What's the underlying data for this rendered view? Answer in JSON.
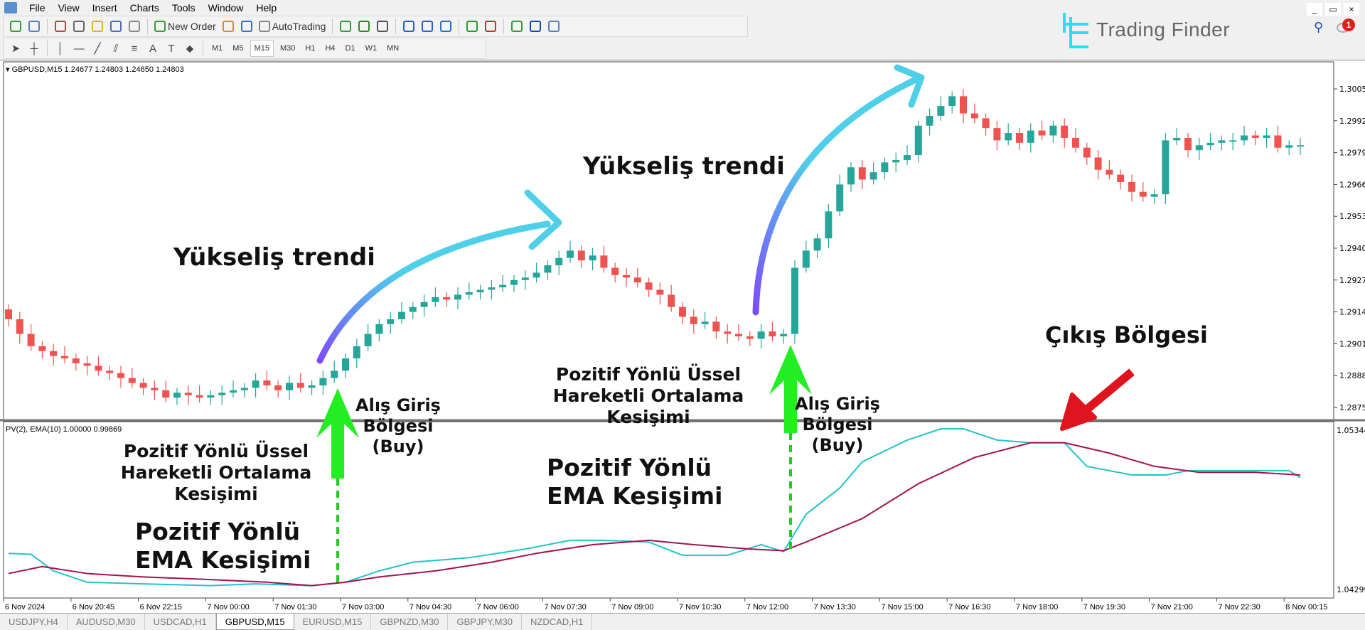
{
  "menu": [
    "File",
    "View",
    "Insert",
    "Charts",
    "Tools",
    "Window",
    "Help"
  ],
  "toolbar": {
    "new_order": "New Order",
    "autotrading": "AutoTrading",
    "icons": [
      "new-chart-icon",
      "profiles-icon",
      "market-watch-icon",
      "navigator-icon",
      "favorites-icon",
      "terminal-icon",
      "strategy-tester-icon",
      "new-order-icon",
      "metaeditor-icon",
      "signals-icon",
      "autotrading-icon",
      "bar-chart-icon",
      "candlestick-icon",
      "line-chart-icon",
      "zoom-in-icon",
      "zoom-out-icon",
      "tile-windows-icon",
      "autoscroll-icon",
      "chart-shift-icon",
      "indicators-icon",
      "periods-icon",
      "templates-icon"
    ]
  },
  "drawing_tools": [
    "cursor-icon",
    "crosshair-icon",
    "vertical-line-icon",
    "horizontal-line-icon",
    "trendline-icon",
    "channel-icon",
    "fibonacci-icon",
    "text-icon",
    "text-label-icon",
    "arrows-icon"
  ],
  "timeframes": [
    "M1",
    "M5",
    "M15",
    "M30",
    "H1",
    "H4",
    "D1",
    "W1",
    "MN"
  ],
  "active_timeframe": "M15",
  "logo": {
    "text": "Trading Finder",
    "color": "#1ee3f0"
  },
  "notifications": {
    "count": "1"
  },
  "window_controls": [
    "_",
    "▭",
    "×"
  ],
  "chart": {
    "header": "GBPUSD,M15  1.24677 1.24803 1.24650 1.24803",
    "indicator_header": "PV(2), EMA(10) 1.00000 0.99869",
    "price_ticks": [
      "1.30050",
      "1.29920",
      "1.29790",
      "1.29660",
      "1.29530",
      "1.29400",
      "1.29270",
      "1.29140",
      "1.29010",
      "1.28880",
      "1.28750"
    ],
    "indicator_ticks": [
      "1.05344",
      "1.04299"
    ],
    "time_labels": [
      "6 Nov 2024",
      "6 Nov 20:45",
      "6 Nov 22:15",
      "7 Nov 00:00",
      "7 Nov 01:30",
      "7 Nov 03:00",
      "7 Nov 04:30",
      "7 Nov 06:00",
      "7 Nov 07:30",
      "7 Nov 09:00",
      "7 Nov 10:30",
      "7 Nov 12:00",
      "7 Nov 13:30",
      "7 Nov 15:00",
      "7 Nov 16:30",
      "7 Nov 18:00",
      "7 Nov 19:30",
      "7 Nov 21:00",
      "7 Nov 22:30",
      "8 Nov 00:15"
    ]
  },
  "chart_data": {
    "type": "candlestick",
    "symbol": "GBPUSD",
    "timeframe": "M15",
    "ylim": [
      1.287,
      1.301
    ],
    "indicator_ylim": [
      1.04299,
      1.05344
    ],
    "colors": {
      "bull": "#26a69a",
      "bear": "#ef5350",
      "pv": "#22c4c8",
      "ema": "#a3124f"
    },
    "close": [
      1.2911,
      1.2905,
      1.29,
      1.2898,
      1.2896,
      1.2895,
      1.2893,
      1.2892,
      1.289,
      1.2889,
      1.2887,
      1.2885,
      1.2883,
      1.2882,
      1.2879,
      1.2881,
      1.288,
      1.2879,
      1.288,
      1.2881,
      1.2882,
      1.2883,
      1.2886,
      1.2884,
      1.2882,
      1.2885,
      1.2883,
      1.2884,
      1.2887,
      1.289,
      1.2895,
      1.29,
      1.2905,
      1.2909,
      1.2911,
      1.2914,
      1.2916,
      1.2918,
      1.292,
      1.2919,
      1.2921,
      1.2922,
      1.2923,
      1.2924,
      1.2925,
      1.2927,
      1.2928,
      1.293,
      1.2933,
      1.2936,
      1.2939,
      1.2935,
      1.2937,
      1.2932,
      1.2929,
      1.2928,
      1.2926,
      1.2923,
      1.2921,
      1.2916,
      1.2912,
      1.2909,
      1.291,
      1.2906,
      1.2905,
      1.2904,
      1.2903,
      1.2906,
      1.2904,
      1.2905,
      1.2932,
      1.2939,
      1.2944,
      1.2955,
      1.2966,
      1.2973,
      1.2968,
      1.2971,
      1.2975,
      1.2976,
      1.2978,
      1.299,
      1.2994,
      1.2998,
      1.3002,
      1.2995,
      1.2993,
      1.2989,
      1.2984,
      1.2987,
      1.2983,
      1.2988,
      1.2986,
      1.299,
      1.2985,
      1.2981,
      1.2977,
      1.2972,
      1.297,
      1.2967,
      1.2963,
      1.2961,
      1.2962,
      1.2984,
      1.2985,
      1.298,
      1.2982,
      1.2983,
      1.2984,
      1.2984,
      1.2986,
      1.2985,
      1.2986,
      1.2981,
      1.2982,
      1.2982
    ],
    "series": [
      {
        "name": "PV(2)",
        "points": [
          [
            0,
            1.04541
          ],
          [
            2,
            1.04535
          ],
          [
            4,
            1.04428
          ],
          [
            7,
            1.04355
          ],
          [
            12,
            1.04344
          ],
          [
            18,
            1.04333
          ],
          [
            22,
            1.04344
          ],
          [
            27,
            1.04333
          ],
          [
            30,
            1.04355
          ],
          [
            33,
            1.04428
          ],
          [
            36,
            1.04484
          ],
          [
            41,
            1.04513
          ],
          [
            46,
            1.04569
          ],
          [
            50,
            1.04625
          ],
          [
            53,
            1.04625
          ],
          [
            57,
            1.04614
          ],
          [
            60,
            1.04529
          ],
          [
            64,
            1.04529
          ],
          [
            67,
            1.04597
          ],
          [
            69,
            1.04552
          ],
          [
            71,
            1.04793
          ],
          [
            74,
            1.04962
          ],
          [
            76,
            1.05131
          ],
          [
            80,
            1.05271
          ],
          [
            83,
            1.05344
          ],
          [
            85,
            1.05344
          ],
          [
            88,
            1.05271
          ],
          [
            91,
            1.05254
          ],
          [
            94,
            1.05254
          ],
          [
            96,
            1.05102
          ],
          [
            100,
            1.05046
          ],
          [
            103,
            1.05046
          ],
          [
            105,
            1.05074
          ],
          [
            109,
            1.05074
          ],
          [
            114,
            1.05074
          ],
          [
            115,
            1.05029
          ]
        ]
      },
      {
        "name": "EMA(10)",
        "points": [
          [
            0,
            1.04411
          ],
          [
            3,
            1.04456
          ],
          [
            7,
            1.04411
          ],
          [
            12,
            1.04389
          ],
          [
            18,
            1.04372
          ],
          [
            23,
            1.04355
          ],
          [
            27,
            1.04333
          ],
          [
            30,
            1.04355
          ],
          [
            33,
            1.04389
          ],
          [
            38,
            1.04428
          ],
          [
            43,
            1.04484
          ],
          [
            47,
            1.04541
          ],
          [
            52,
            1.04597
          ],
          [
            57,
            1.04625
          ],
          [
            61,
            1.04597
          ],
          [
            66,
            1.04569
          ],
          [
            69,
            1.04558
          ],
          [
            71,
            1.04614
          ],
          [
            76,
            1.04765
          ],
          [
            81,
            1.0499
          ],
          [
            86,
            1.05159
          ],
          [
            91,
            1.05254
          ],
          [
            94,
            1.05254
          ],
          [
            98,
            1.05187
          ],
          [
            102,
            1.05102
          ],
          [
            106,
            1.05063
          ],
          [
            111,
            1.05063
          ],
          [
            115,
            1.05046
          ]
        ]
      }
    ]
  },
  "annotations": {
    "trend1": "Yükseliş trendi",
    "trend2": "Yükseliş trendi",
    "exit": "Çıkış Bölgesi",
    "cross1": [
      "Pozitif Yönlü Üssel",
      "Hareketli Ortalama",
      "Kesişimi"
    ],
    "ema1": [
      "Pozitif Yönlü",
      "EMA Kesişimi"
    ],
    "buy1": [
      "Alış Giriş",
      "Bölgesi",
      "(Buy)"
    ],
    "cross2": [
      "Pozitif Yönlü Üssel",
      "Hareketli Ortalama",
      "Kesişimi"
    ],
    "ema2": [
      "Pozitif Yönlü",
      "EMA Kesişimi"
    ],
    "buy2": [
      "Alış Giriş",
      "Bölgesi",
      "(Buy)"
    ],
    "colors": {
      "buy_arrow": "#22ee22",
      "exit_arrow": "#e0141e",
      "trend_start": "#7b4dff",
      "trend_end": "#4fd0e8"
    }
  },
  "tabs": [
    "USDJPY,H4",
    "AUDUSD,M30",
    "USDCAD,H1",
    "GBPUSD,M15",
    "EURUSD,M15",
    "GBPNZD,M30",
    "GBPJPY,M30",
    "NZDCAD,H1"
  ],
  "active_tab": "GBPUSD,M15"
}
